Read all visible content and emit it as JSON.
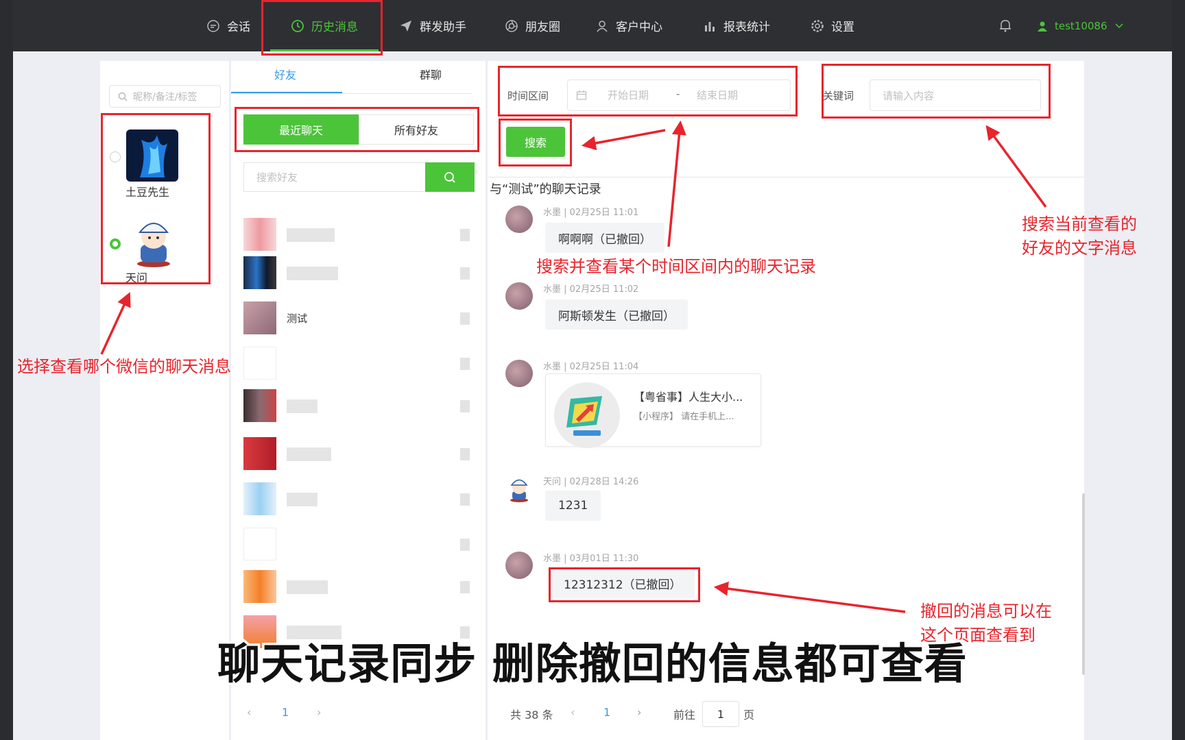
{
  "nav": {
    "items": [
      {
        "label": "会话",
        "icon": "chat-icon"
      },
      {
        "label": "历史消息",
        "icon": "clock-icon"
      },
      {
        "label": "群发助手",
        "icon": "send-icon"
      },
      {
        "label": "朋友圈",
        "icon": "aperture-icon"
      },
      {
        "label": "客户中心",
        "icon": "person-icon"
      },
      {
        "label": "报表统计",
        "icon": "bar-chart-icon"
      },
      {
        "label": "设置",
        "icon": "gear-icon"
      }
    ],
    "active_index": 1,
    "username": "test10086",
    "accent": "#4cc43a"
  },
  "accounts": {
    "search_placeholder": "昵称/备注/标签",
    "items": [
      {
        "name": "土豆先生",
        "selected": false
      },
      {
        "name": "天问",
        "selected": true
      }
    ]
  },
  "friends": {
    "tabs": [
      "好友",
      "群聊"
    ],
    "segments": [
      "最近聊天",
      "所有好友"
    ],
    "search_placeholder": "搜索好友",
    "visible_name": "测试",
    "current_page": "1"
  },
  "filters": {
    "time_label": "时间区间",
    "start_placeholder": "开始日期",
    "date_separator": "-",
    "end_placeholder": "结束日期",
    "keyword_label": "关键词",
    "keyword_placeholder": "请输入内容",
    "search_button": "搜索"
  },
  "chat": {
    "title": "与“测试”的聊天记录",
    "messages": [
      {
        "meta": "水墨 | 02月25日 11:01",
        "text": "啊啊啊（已撤回）"
      },
      {
        "meta": "水墨 | 02月25日 11:02",
        "text": "阿斯顿发生（已撤回）"
      },
      {
        "meta": "水墨 | 02月25日 11:04",
        "card_title": "【粤省事】人生大小...",
        "card_sub": "【小程序】 请在手机上..."
      },
      {
        "meta": "天问 | 02月28日 14:26",
        "text": "1231"
      },
      {
        "meta": "水墨 | 03月01日 11:30",
        "text": "12312312（已撤回）"
      }
    ],
    "pager": {
      "total": "共 38 条",
      "current": "1",
      "goto": "前往",
      "goto_value": "1",
      "page_unit": "页"
    }
  },
  "annotations": {
    "select_account": "选择查看哪个微信的聊天消息",
    "time_search": "搜索并查看某个时间区间内的聊天记录",
    "keyword_line1": "搜索当前查看的",
    "keyword_line2": "好友的文字消息",
    "recall_line1": "撤回的消息可以在",
    "recall_line2": "这个页面查看到",
    "caption": "聊天记录同步 删除撤回的信息都可查看"
  }
}
